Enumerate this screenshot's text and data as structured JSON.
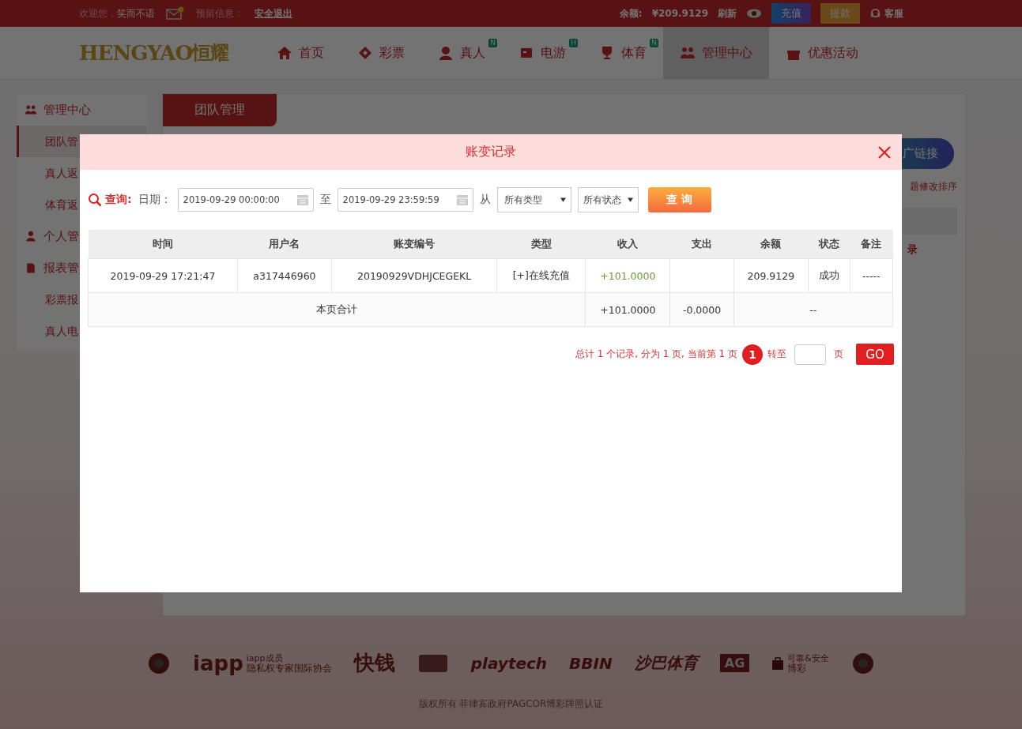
{
  "top_bar": {
    "welcome": "欢迎您，",
    "username": "笑而不语",
    "has_new_mail": true,
    "reserve_label": "预留信息：",
    "logout": "安全退出",
    "balance_label": "余额:",
    "balance": "¥209.9129",
    "refresh": "刷新",
    "deposit": "充值",
    "withdraw": "提款",
    "service": "客服"
  },
  "logo": {
    "latin": "HENGYAO",
    "chinese": "恒耀"
  },
  "nav": [
    {
      "label": "首页",
      "selected": false
    },
    {
      "label": "彩票",
      "selected": false
    },
    {
      "label": "真人",
      "badge": "N",
      "selected": false
    },
    {
      "label": "电游",
      "badge": "H",
      "selected": false
    },
    {
      "label": "体育",
      "badge": "N",
      "selected": false
    },
    {
      "label": "管理中心",
      "selected": true
    },
    {
      "label": "优惠活动",
      "selected": false
    }
  ],
  "sidebar": [
    {
      "label": "管理中心",
      "children": [
        {
          "label": "团队管",
          "selected": true
        },
        {
          "label": "真人返",
          "selected": false
        },
        {
          "label": "体育返",
          "selected": false
        }
      ]
    },
    {
      "label": "个人管"
    },
    {
      "label": "报表管",
      "children": [
        {
          "label": "彩票报",
          "selected": false
        },
        {
          "label": "真人电",
          "selected": false
        }
      ]
    }
  ],
  "panel": {
    "tab": "团队管理",
    "link_button": "广链接",
    "hint": "题修改排序",
    "row_link": "录"
  },
  "modal": {
    "title": "账变记录",
    "query_label": "查询:",
    "date_label": "日期：",
    "start": "2019-09-29 00:00:00",
    "to": "至",
    "end": "2019-09-29 23:59:59",
    "from": "从",
    "type_select": "所有类型",
    "status_select": "所有状态",
    "query_button": "查 询",
    "table": {
      "columns": [
        "时间",
        "用户名",
        "账变编号",
        "类型",
        "收入",
        "支出",
        "余额",
        "状态",
        "备注"
      ],
      "rows": [
        [
          "2019-09-29 17:21:47",
          "a317446960",
          "20190929VDHJCEGEKL",
          "[+]在线充值",
          "+101.0000",
          "",
          "209.9129",
          "成功",
          "-----"
        ]
      ],
      "summary": {
        "label": "本页合计",
        "income": "+101.0000",
        "expense": "-0.0000",
        "rest": "--"
      }
    },
    "pagination": {
      "summary": "总计 1 个记录, 分为 1 页, 当前第 1 页",
      "pages": [
        {
          "label": "1",
          "selected": true
        }
      ],
      "goto": "转至",
      "unit": "页",
      "go": "GO"
    }
  },
  "footer": {
    "logos": [
      {
        "kind": "seal"
      },
      {
        "kind": "iapp",
        "text": "iapp",
        "lines": [
          "iapp成员",
          "隐私权专家国际协会"
        ]
      },
      {
        "kind": "calligraphy",
        "text": "快钱"
      },
      {
        "kind": "card"
      },
      {
        "kind": "brand",
        "text": "playtech"
      },
      {
        "kind": "brand",
        "text": "BBIN"
      },
      {
        "kind": "brand",
        "text": "沙巴体育"
      },
      {
        "kind": "box",
        "text": "AG"
      },
      {
        "kind": "iapp",
        "lines": [
          "可靠&安全",
          "博彩"
        ]
      },
      {
        "kind": "seal"
      }
    ],
    "copyright": "版权所有 菲律宾政府PAGCOR博彩牌照认证"
  }
}
